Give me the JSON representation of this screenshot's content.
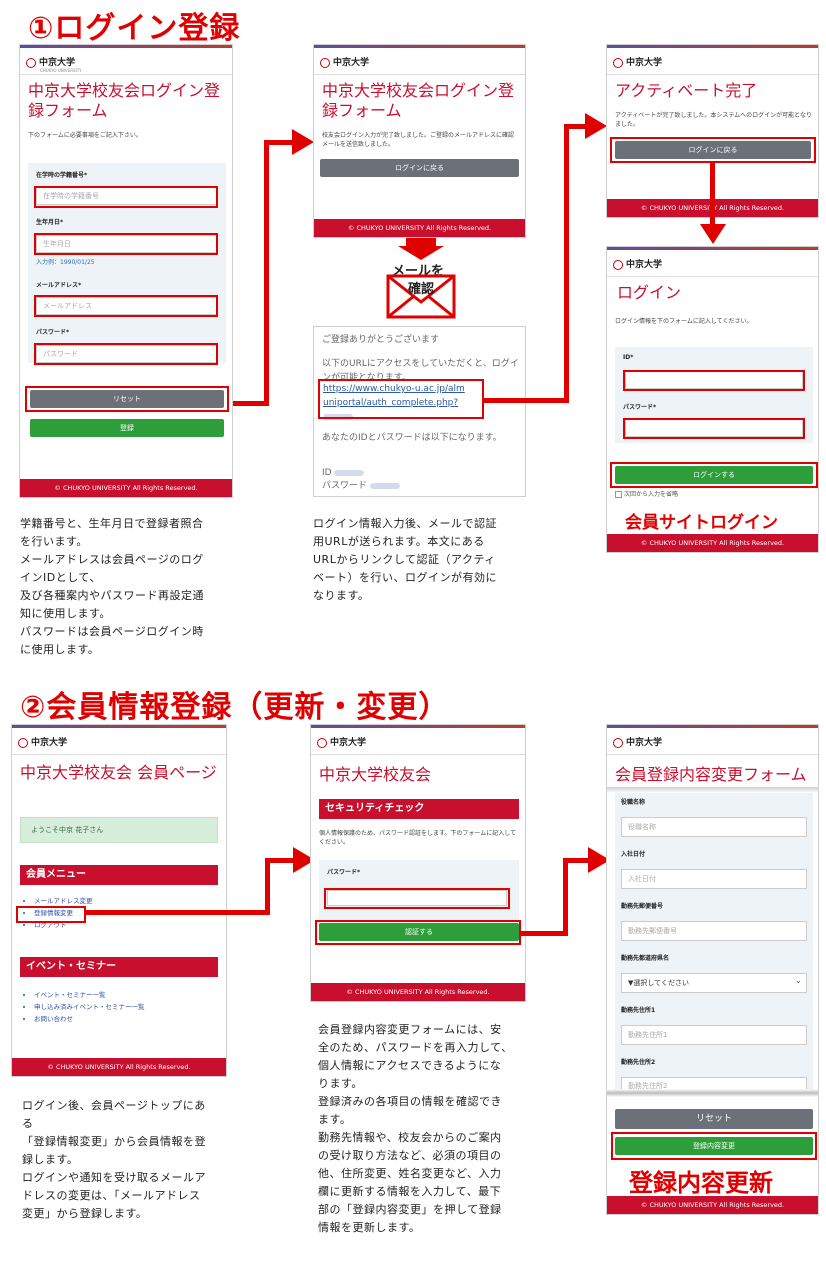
{
  "section1": {
    "title": "①ログイン登録",
    "panel_a": {
      "logo": "中京大学",
      "logo_sub": "CHUKYO UNIVERSITY",
      "title": "中京大学校友会ログイン登録フォーム",
      "intro": "下のフォームに必要事項をご記入下さい。",
      "student_label": "在学時の学籍番号*",
      "student_placeholder": "在学時の学籍番号",
      "dob_label": "生年月日*",
      "dob_placeholder": "生年月日",
      "dob_example": "入力例：1990/01/25",
      "email_label": "メールアドレス*",
      "email_placeholder": "メールアドレス",
      "password_label": "パスワード*",
      "password_placeholder": "パスワード",
      "reset_label": "リセット",
      "register_label": "登録",
      "footer": "© CHUKYO UNIVERSITY All Rights Reserved."
    },
    "panel_b": {
      "logo": "中京大学",
      "title": "中京大学校友会ログイン登録フォーム",
      "message": "校友会ログイン入力が完了致しました。ご登録のメールアドレスに確認メールを送信致しました。",
      "back_label": "ログインに戻る",
      "footer": "© CHUKYO UNIVERSITY All Rights Reserved."
    },
    "mail_label_1": "メールを",
    "mail_label_2": "確認",
    "mail": {
      "thanks": "ご登録ありがとうございます",
      "access": "以下のURLにアクセスをしていただくと、ログインが可能となります。",
      "link_1": "https://www.chukyo-u.ac.jp/alm",
      "link_2": "uniportal/auth_complete.php?",
      "id_pw": "あなたのIDとパスワードは以下になります。",
      "id_label": "ID",
      "pw_label": "パスワード"
    },
    "panel_c": {
      "logo": "中京大学",
      "title": "アクティベート完了",
      "message": "アクティベートが完了致しました。本システムへのログインが可能となりました。",
      "back_label": "ログインに戻る",
      "footer": "© CHUKYO UNIVERSITY All Rights Reserved."
    },
    "panel_d": {
      "logo": "中京大学",
      "title": "ログイン",
      "intro": "ログイン情報を下のフォームに記入してください。",
      "id_label": "ID*",
      "password_label": "パスワード*",
      "login_label": "ログインする",
      "remember": "次回から入力を省略",
      "caption": "会員サイトログイン",
      "footer": "© CHUKYO UNIVERSITY All Rights Reserved."
    },
    "desc_left": [
      "学籍番号と、生年月日で登録者照合",
      "を行います。",
      "メールアドレスは会員ページのログ",
      "インIDとして、",
      "及び各種案内やパスワード再設定通",
      "知に使用します。",
      "パスワードは会員ページログイン時",
      "に使用します。"
    ],
    "desc_mid": [
      "ログイン情報入力後、メールで認証",
      "用URLが送られます。本文にある",
      "URLからリンクして認証（アクティ",
      "ベート）を行い、ログインが有効に",
      "なります。"
    ]
  },
  "section2": {
    "title": "②会員情報登録（更新・変更）",
    "panel_e": {
      "logo": "中京大学",
      "title": "中京大学校友会 会員ページ",
      "welcome": "ようこそ中京 花子さん",
      "menu_head": "会員メニュー",
      "menu": [
        "メールアドレス変更",
        "登録情報変更",
        "ログアウト"
      ],
      "event_head": "イベント・セミナー",
      "events": [
        "イベント・セミナー一覧",
        "申し込み済みイベント・セミナー一覧",
        "お問い合わせ"
      ],
      "footer": "© CHUKYO UNIVERSITY All Rights Reserved."
    },
    "panel_f": {
      "logo": "中京大学",
      "title": "中京大学校友会",
      "security_head": "セキュリティチェック",
      "message": "個人情報保護のため、パスワード認証をします。下のフォームに記入してください。",
      "password_label": "パスワード*",
      "auth_label": "認証する",
      "footer": "© CHUKYO UNIVERSITY All Rights Reserved."
    },
    "panel_g": {
      "logo": "中京大学",
      "title": "会員登録内容変更フォーム",
      "fields": [
        {
          "label": "役職名称",
          "placeholder": "役職名称"
        },
        {
          "label": "入社日付",
          "placeholder": "入社日付"
        },
        {
          "label": "勤務先郵便番号",
          "placeholder": "勤務先郵便番号"
        },
        {
          "label": "勤務先都道府県名",
          "placeholder": "▼選択してください"
        },
        {
          "label": "勤務先住所1",
          "placeholder": "勤務先住所1"
        },
        {
          "label": "勤務先住所2",
          "placeholder": "勤務先住所2"
        }
      ],
      "reset_label": "リセット",
      "update_label": "登録内容変更",
      "caption": "登録内容更新",
      "footer": "© CHUKYO UNIVERSITY All Rights Reserved."
    },
    "desc_left": [
      "ログイン後、会員ページトップにあ",
      "る",
      "「登録情報変更」から会員情報を登",
      "録します。",
      "ログインや通知を受け取るメールア",
      "ドレスの変更は、「メールアドレス",
      "変更」から登録します。"
    ],
    "desc_mid": [
      "会員登録内容変更フォームには、安",
      "全のため、パスワードを再入力して、",
      "個人情報にアクセスできるようにな",
      "ります。",
      "登録済みの各項目の情報を確認でき",
      "ます。",
      "勤務先情報や、校友会からのご案内",
      "の受け取り方法など、必須の項目の",
      "他、住所変更、姓名変更など、入力",
      "欄に更新する情報を入力して、最下",
      "部の「登録内容変更」を押して登録",
      "情報を更新します。"
    ]
  },
  "colors": {
    "accent_red": "#e10000",
    "brand_red": "#c8102e",
    "green": "#2e9e3b",
    "gray_button": "#6c7079"
  }
}
